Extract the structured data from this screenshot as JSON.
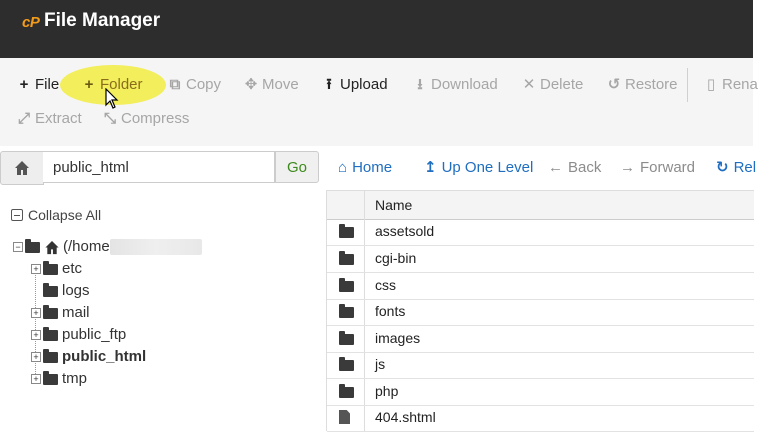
{
  "app": {
    "logo": "cP",
    "title": "File Manager"
  },
  "toolbar": {
    "file": "File",
    "folder": "Folder",
    "copy": "Copy",
    "move": "Move",
    "upload": "Upload",
    "download": "Download",
    "delete": "Delete",
    "restore": "Restore",
    "rename": "Rena",
    "extract": "Extract",
    "compress": "Compress"
  },
  "path": {
    "value": "public_html",
    "go": "Go"
  },
  "nav": {
    "home": "Home",
    "up": "Up One Level",
    "back": "Back",
    "forward": "Forward",
    "reload": "Rel"
  },
  "tree": {
    "collapse": "Collapse All",
    "root": "(/home",
    "items": [
      "etc",
      "logs",
      "mail",
      "public_ftp",
      "public_html",
      "tmp"
    ]
  },
  "table": {
    "header": "Name",
    "rows": [
      "assetsold",
      "cgi-bin",
      "css",
      "fonts",
      "images",
      "js",
      "php",
      "404.shtml"
    ]
  },
  "colors": {
    "accent_blue": "#1f6ec0",
    "go_green": "#3c8a1c",
    "highlight": "#f2ee5c",
    "logo_orange": "#f39c1b"
  }
}
